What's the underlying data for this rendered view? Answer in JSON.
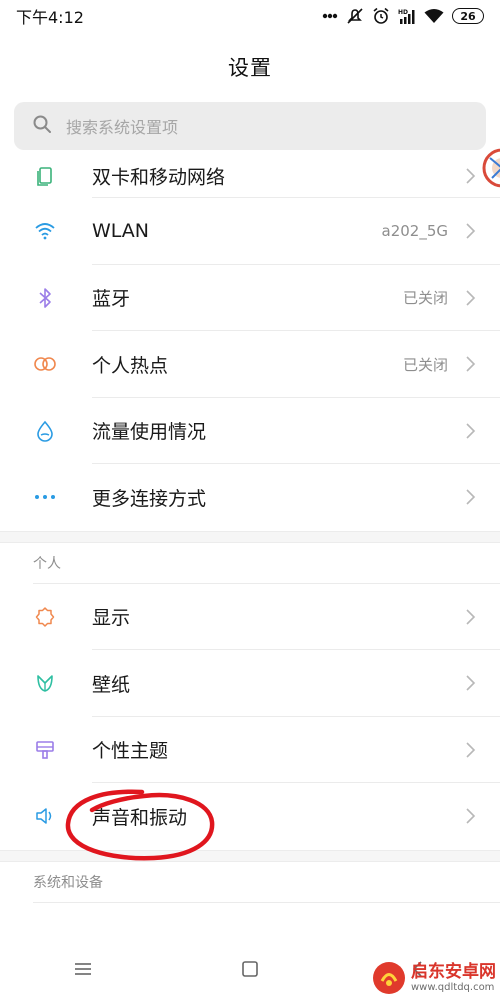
{
  "status_bar": {
    "time": "下午4:12",
    "battery": "26"
  },
  "title": "设置",
  "search": {
    "placeholder": "搜索系统设置项"
  },
  "network_items": [
    {
      "label": "双卡和移动网络",
      "value": "",
      "icon": "sim-card-icon"
    },
    {
      "label": "WLAN",
      "value": "a202_5G",
      "icon": "wifi-icon"
    },
    {
      "label": "蓝牙",
      "value": "已关闭",
      "icon": "bluetooth-icon"
    },
    {
      "label": "个人热点",
      "value": "已关闭",
      "icon": "hotspot-icon"
    },
    {
      "label": "流量使用情况",
      "value": "",
      "icon": "data-usage-icon"
    },
    {
      "label": "更多连接方式",
      "value": "",
      "icon": "more-connections-icon"
    }
  ],
  "section_personal": "个人",
  "personal_items": [
    {
      "label": "显示",
      "icon": "display-icon"
    },
    {
      "label": "壁纸",
      "icon": "wallpaper-icon"
    },
    {
      "label": "个性主题",
      "icon": "theme-icon"
    },
    {
      "label": "声音和振动",
      "icon": "sound-icon"
    }
  ],
  "section_system": "系统和设备",
  "watermark": {
    "title": "启东安卓网",
    "url": "www.qdltdq.com"
  },
  "colors": {
    "wifi": "#2a9be3",
    "bluetooth": "#9b7de8",
    "hotspot": "#f0884e",
    "data": "#2a9be3",
    "display": "#f0884e",
    "wallpaper": "#2fbfa2",
    "theme": "#9b7de8",
    "sound": "#2a9be3",
    "annotation": "#e0161e"
  }
}
